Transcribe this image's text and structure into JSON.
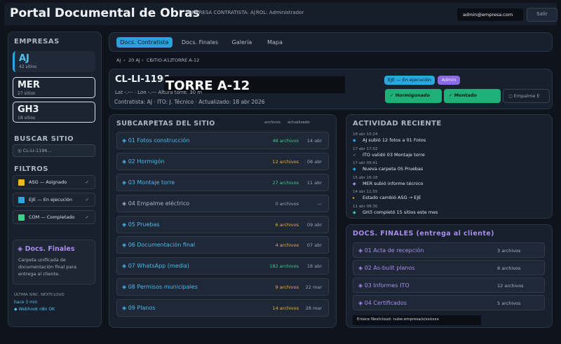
{
  "header": {
    "title": "Portal Documental de Obras",
    "empresa": "EMPRESA CONTRATISTA: AJ",
    "rol": "ROL: Administrador",
    "email": "admin@empresa.com",
    "logout": "Salir"
  },
  "sidebar": {
    "empresas_title": "EMPRESAS",
    "empresas": [
      {
        "code": "AJ",
        "count": "42 sitios"
      },
      {
        "code": "MER",
        "count": "27 sitios"
      },
      {
        "code": "GH3",
        "count": "18 sitios"
      }
    ],
    "buscar_title": "BUSCAR SITIO",
    "search_value": "◎ CL-LI-1196...",
    "filtros_title": "FILTROS",
    "filtros": [
      {
        "label": "ASG — Asignado",
        "color": "#f0b429"
      },
      {
        "label": "EJE — En ejecución",
        "color": "#29a8e0"
      },
      {
        "label": "COM — Completado",
        "color": "#3ecf8e"
      }
    ],
    "check": "✓",
    "docs_title": "◈ Docs. Finales",
    "docs_desc": "Carpeta unificada de documentación final para entrega al cliente.",
    "sync_label": "ÚLTIMA SINC. NEXTCLOUD",
    "sync_time": "hace 3 min",
    "webhook": "◆ Webhook n8n OK"
  },
  "tabs": [
    "Docs. Contratista",
    "Docs. Finales",
    "Galería",
    "Mapa"
  ],
  "breadcrumb": [
    "AJ",
    "›",
    "20 AJ",
    "›",
    "CL",
    "SITIO-A12",
    "TORRE A-12"
  ],
  "site": {
    "code": "CL-LI-1196",
    "name": "TORRE A-12",
    "latlon": "Lat -.--- · Lon -.---   Altura torre: 30 m",
    "contractor": "Contratista: AJ · ITO: J. Técnico · Actualizado: 18 abr 2026",
    "status_pill": "EJE — En ejecución",
    "role_pill": "Admin",
    "stages": [
      "✓  Hormigonado",
      "✓  Montado",
      "○  Empalme E"
    ]
  },
  "subcarpetas": {
    "title": "SUBCARPETAS DEL SITIO",
    "col_archivos": "archivos",
    "col_actualizado": "actualizado",
    "rows": [
      {
        "name": "◈ 01 Fotos construcción",
        "count": "48 archivos",
        "date": "14 abr",
        "color": "#3ecf8e"
      },
      {
        "name": "◈ 02 Hormigón",
        "count": "12 archivos",
        "date": "08 abr",
        "color": "#f0b429"
      },
      {
        "name": "◈ 03 Montaje torre",
        "count": "27 archivos",
        "date": "11 abr",
        "color": "#3ecf8e"
      },
      {
        "name": "◈ 04 Empalme eléctrico",
        "count": "0 archivos",
        "date": "—",
        "color": "#9aa7b8"
      },
      {
        "name": "◈ 05 Pruebas",
        "count": "6 archivos",
        "date": "09 abr",
        "color": "#f0b429"
      },
      {
        "name": "◈ 06 Documentación final",
        "count": "4 archivos",
        "date": "07 abr",
        "color": "#f0b429"
      },
      {
        "name": "◈ 07 WhatsApp (media)",
        "count": "182 archivos",
        "date": "18 abr",
        "color": "#3ecf8e"
      },
      {
        "name": "◈ 08 Permisos municipales",
        "count": "9 archivos",
        "date": "22 mar",
        "color": "#f0b429"
      },
      {
        "name": "◈ 09 Planos",
        "count": "14 archivos",
        "date": "28 mar",
        "color": "#f0b429"
      }
    ]
  },
  "actividad": {
    "title": "ACTIVIDAD RECIENTE",
    "items": [
      {
        "time": "18 abr 10:24",
        "icon": "◆",
        "icon_color": "#29a8e0",
        "text": "AJ subió 12 fotos a 01 Fotos"
      },
      {
        "time": "17 abr 17:02",
        "icon": "✓",
        "icon_color": "#9aa7b8",
        "text": "ITO validó 03 Montaje torre"
      },
      {
        "time": "17 abr 09:41",
        "icon": "◆",
        "icon_color": "#29a8e0",
        "text": "Nueva carpeta 05 Pruebas"
      },
      {
        "time": "15 abr 16:18",
        "icon": "◆",
        "icon_color": "#a98cf0",
        "text": "MER subió informe técnico"
      },
      {
        "time": "14 abr 11:55",
        "icon": "▸",
        "icon_color": "#f0b429",
        "text": "Estado cambió ASG → EJE"
      },
      {
        "time": "11 abr 08:30",
        "icon": "◆",
        "icon_color": "#3ecf8e",
        "text": "GH3 completó 15 sitios este mes"
      }
    ]
  },
  "docs_finales": {
    "title": "DOCS. FINALES (entrega al cliente)",
    "rows": [
      {
        "name": "◈ 01 Acta de recepción",
        "count": "3 archivos"
      },
      {
        "name": "◈ 02 As-built planos",
        "count": "8 archivos"
      },
      {
        "name": "◈ 03 Informes ITO",
        "count": "12 archivos"
      },
      {
        "name": "◈ 04 Certificados",
        "count": "5 archivos"
      }
    ],
    "link": "Enlace Nextcloud: nube.empresa/s/xxxxxx"
  }
}
